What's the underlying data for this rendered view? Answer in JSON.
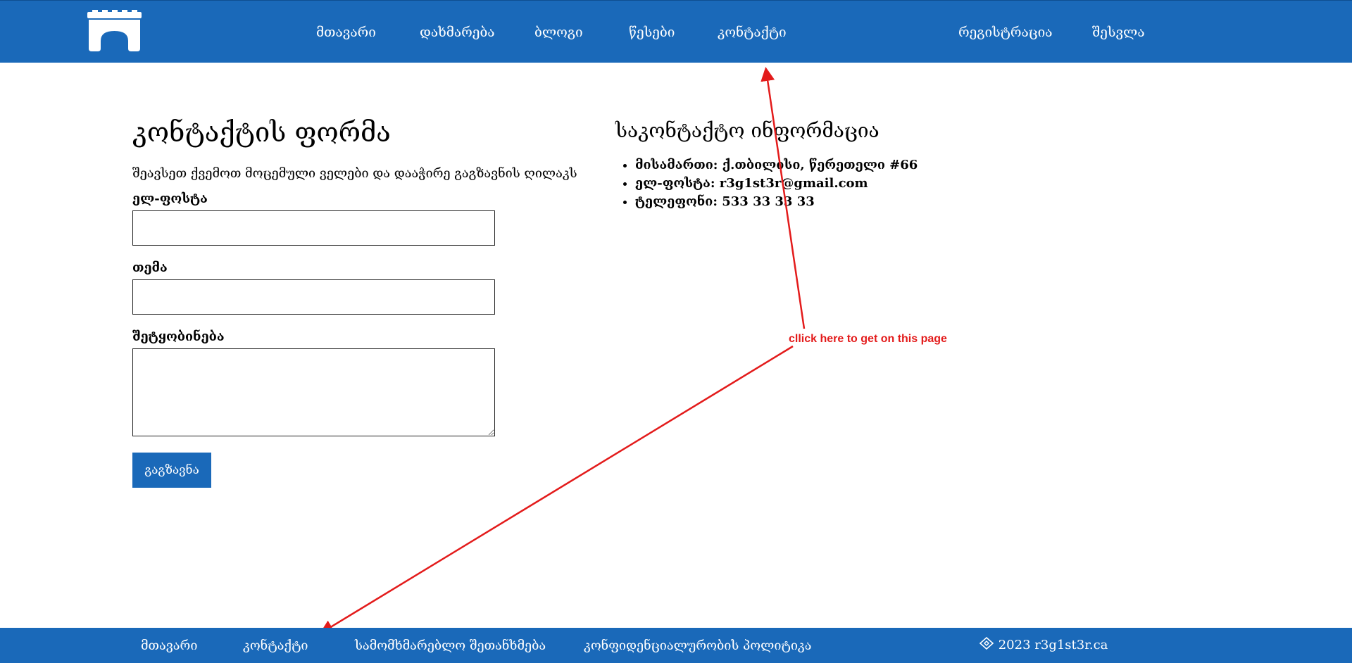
{
  "header": {
    "nav": [
      {
        "label": "მთავარი"
      },
      {
        "label": "დახმარება"
      },
      {
        "label": "ბლოგი"
      },
      {
        "label": "წესები"
      },
      {
        "label": "კონტაქტი"
      }
    ],
    "auth": {
      "register": "რეგისტრაცია",
      "login": "შესვლა"
    }
  },
  "form": {
    "title": "კონტაქტის ფორმა",
    "description": "შეავსეთ ქვემოთ მოცემული ველები და დააჭირე გაგზავნის ღილაკს",
    "email_label": "ელ-ფოსტა",
    "email_value": "",
    "subject_label": "თემა",
    "subject_value": "",
    "message_label": "შეტყობინება",
    "message_value": "",
    "submit_label": "გაგზავნა"
  },
  "contact_info": {
    "title": "საკონტაქტო ინფორმაცია",
    "items": [
      {
        "text": "მისამართი: ქ.თბილისი, წერეთელი #66"
      },
      {
        "text": "ელ-ფოსტა: r3g1st3r@gmail.com"
      },
      {
        "text": "ტელეფონი: 533 33 33 33"
      }
    ]
  },
  "annotation": {
    "text": "cllick here to get on this page",
    "color": "#e31b1b"
  },
  "footer": {
    "links": [
      {
        "label": "მთავარი"
      },
      {
        "label": "კონტაქტი"
      },
      {
        "label": "სამომხმარებლო შეთანხმება"
      },
      {
        "label": "კონფიდენციალურობის პოლიტიკა"
      }
    ],
    "copyright_icon": "copyright-icon",
    "copyright": "2023 r3g1st3r.ca"
  },
  "colors": {
    "brand": "#1a69b9",
    "annotation": "#e31b1b"
  }
}
